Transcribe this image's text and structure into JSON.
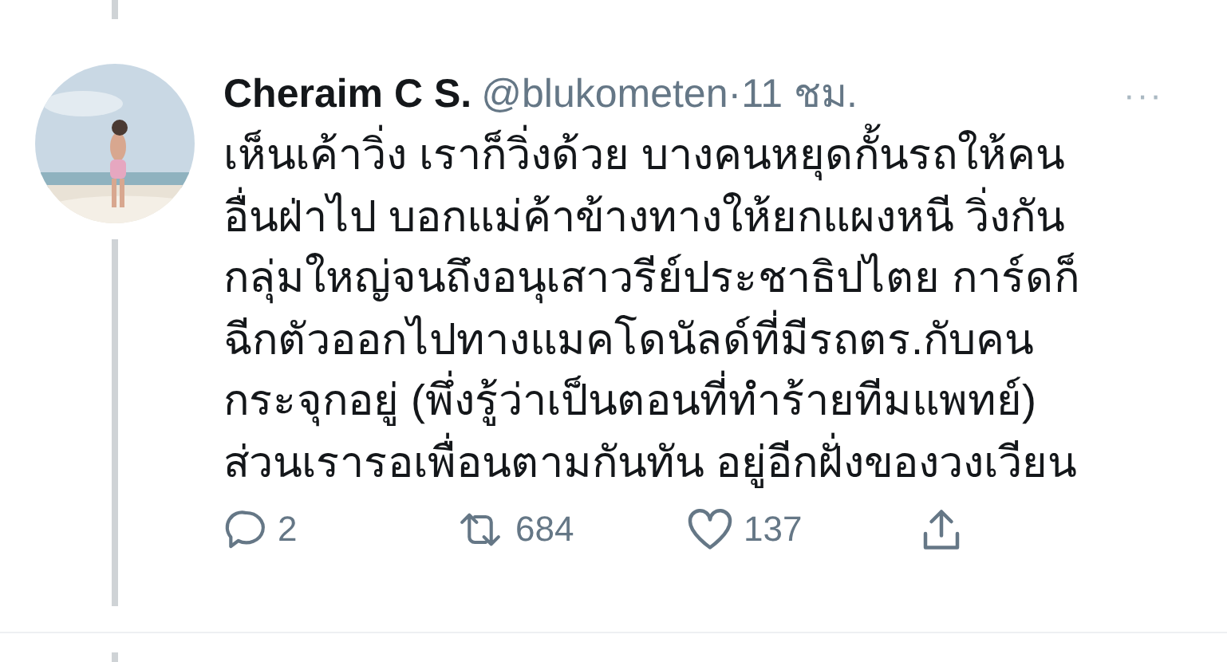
{
  "tweet": {
    "name": "Cheraim C S.",
    "handle": "@blukometen",
    "separator": "·",
    "time": "11 ชม.",
    "more": "···",
    "body_lines": [
      "เห็นเค้าวิ่ง เราก็วิ่งด้วย บางคนหยุดกั้นรถให้คน",
      "อื่นฝ่าไป บอกแม่ค้าข้างทางให้ยกแผงหนี วิ่งกัน",
      "กลุ่มใหญ่จนถึงอนุเสาวรีย์ประชาธิปไตย การ์ดก็",
      "ฉีกตัวออกไปทางแมคโดนัลด์ที่มีรถตร.กับคน",
      "กระจุกอยู่ (พึ่งรู้ว่าเป็นตอนที่ทำร้ายทีมแพทย์)",
      "ส่วนเรารอเพื่อนตามกันทัน อยู่อีกฝั่งของวงเวียน"
    ],
    "actions": [
      {
        "kind": "reply",
        "count": "2"
      },
      {
        "kind": "retweet",
        "count": "684"
      },
      {
        "kind": "like",
        "count": "137"
      },
      {
        "kind": "share"
      }
    ]
  }
}
